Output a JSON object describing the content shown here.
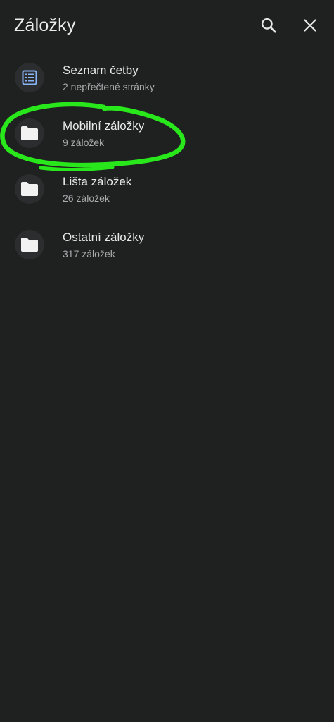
{
  "header": {
    "title": "Záložky",
    "search_icon": "search-icon",
    "close_icon": "close-icon"
  },
  "bookmarks": [
    {
      "label": "Seznam četby",
      "subtitle": "2 nepřečtené stránky",
      "icon": "reading-list-icon"
    },
    {
      "label": "Mobilní záložky",
      "subtitle": "9 záložek",
      "icon": "folder-icon"
    },
    {
      "label": "Lišta záložek",
      "subtitle": "26 záložek",
      "icon": "folder-icon"
    },
    {
      "label": "Ostatní záložky",
      "subtitle": "317 záložek",
      "icon": "folder-icon"
    }
  ],
  "colors": {
    "background": "#1f2020",
    "icon_circle": "#2b2d2e",
    "reading_list_accent": "#8ab4f8",
    "annotation": "#28e81c"
  }
}
